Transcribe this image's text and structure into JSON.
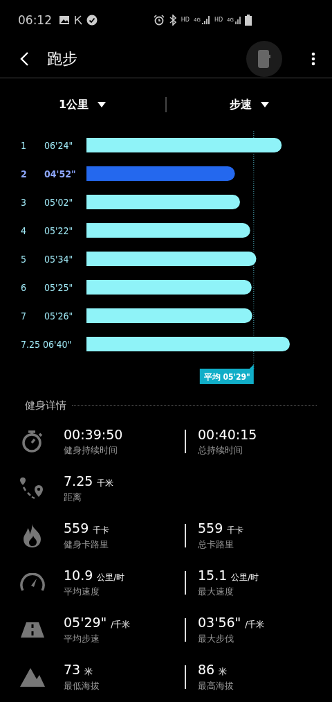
{
  "status_bar": {
    "time": "06:12",
    "network_labels": [
      "HD",
      "4G",
      "HD",
      "4G"
    ]
  },
  "header": {
    "title": "跑步"
  },
  "filters": [
    {
      "label": "1公里"
    },
    {
      "label": "步速"
    }
  ],
  "splits": [
    {
      "label": "1",
      "pace": "06'24\"",
      "selected": false
    },
    {
      "label": "2",
      "pace": "04'52\"",
      "selected": true
    },
    {
      "label": "3",
      "pace": "05'02\"",
      "selected": false
    },
    {
      "label": "4",
      "pace": "05'22\"",
      "selected": false
    },
    {
      "label": "5",
      "pace": "05'34\"",
      "selected": false
    },
    {
      "label": "6",
      "pace": "05'25\"",
      "selected": false
    },
    {
      "label": "7",
      "pace": "05'26\"",
      "selected": false
    },
    {
      "label": "7.25",
      "pace": "06'40\"",
      "selected": false
    }
  ],
  "average": {
    "label": "平均 05'29\""
  },
  "details": {
    "title": "健身详情",
    "rows": [
      {
        "kind": "stopwatch",
        "left": {
          "value": "00:39:50",
          "label": "健身持续时间"
        },
        "right": {
          "value": "00:40:15",
          "label": "总持续时间"
        }
      },
      {
        "kind": "route",
        "left": {
          "value": "7.25",
          "unit": "千米",
          "label": "距离"
        }
      },
      {
        "kind": "flame",
        "left": {
          "value": "559",
          "unit": "千卡",
          "label": "健身卡路里"
        },
        "right": {
          "value": "559",
          "unit": "千卡",
          "label": "总卡路里"
        }
      },
      {
        "kind": "speedometer",
        "left": {
          "value": "10.9",
          "unit": "公里/时",
          "label": "平均速度"
        },
        "right": {
          "value": "15.1",
          "unit": "公里/时",
          "label": "最大速度"
        }
      },
      {
        "kind": "road",
        "left": {
          "value": "05'29\"",
          "unit": "/千米",
          "label": "平均步速"
        },
        "right": {
          "value": "03'56\"",
          "unit": "/千米",
          "label": "最大步伐"
        }
      },
      {
        "kind": "mountain",
        "left": {
          "value": "73",
          "unit": "米",
          "label": "最低海拔"
        },
        "right": {
          "value": "86",
          "unit": "米",
          "label": "最高海拔"
        }
      }
    ]
  }
}
